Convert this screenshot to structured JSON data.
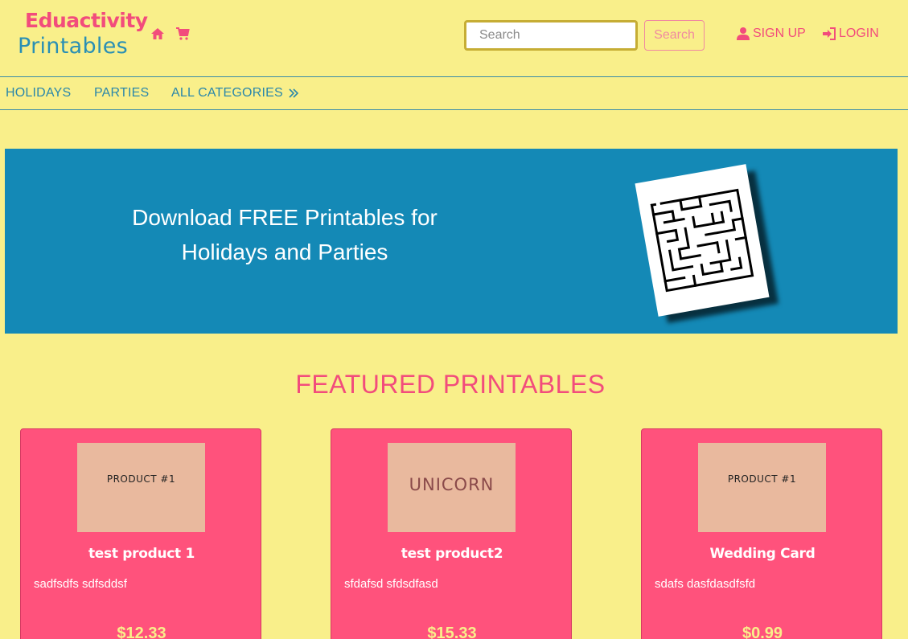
{
  "header": {
    "logo_top": "Eduactivity",
    "logo_bottom": "Printables",
    "search_placeholder": "Search",
    "search_button": "Search",
    "signup_label": "SIGN UP",
    "login_label": "LOGIN",
    "icons": [
      "home-icon",
      "cart-icon",
      "user-icon",
      "sign-in-icon"
    ]
  },
  "nav": {
    "items": [
      "HOLIDAYS",
      "PARTIES",
      "ALL CATEGORIES"
    ],
    "more_icon": "double-chevron-right-icon"
  },
  "banner": {
    "line1": "Download FREE Printables for",
    "line2": "Holidays and Parties"
  },
  "featured": {
    "title": "FEATURED PRINTABLES",
    "products": [
      {
        "thumb_text": "PRODUCT #1",
        "title": "test product 1",
        "desc": "sadfsdfs sdfsddsf",
        "price": "$12.33"
      },
      {
        "thumb_text": "UNICORN",
        "title": "test product2",
        "desc": "sfdafsd sfdsdfasd",
        "price": "$15.33"
      },
      {
        "thumb_text": "PRODUCT #1",
        "title": "Wedding Card",
        "desc": "sdafs dasfdasdfsfd",
        "price": "$0.99"
      }
    ]
  },
  "colors": {
    "background": "#f9ef8a",
    "accent_pink": "#f24c7c",
    "accent_blue": "#1489b6",
    "card": "#ff527c"
  }
}
